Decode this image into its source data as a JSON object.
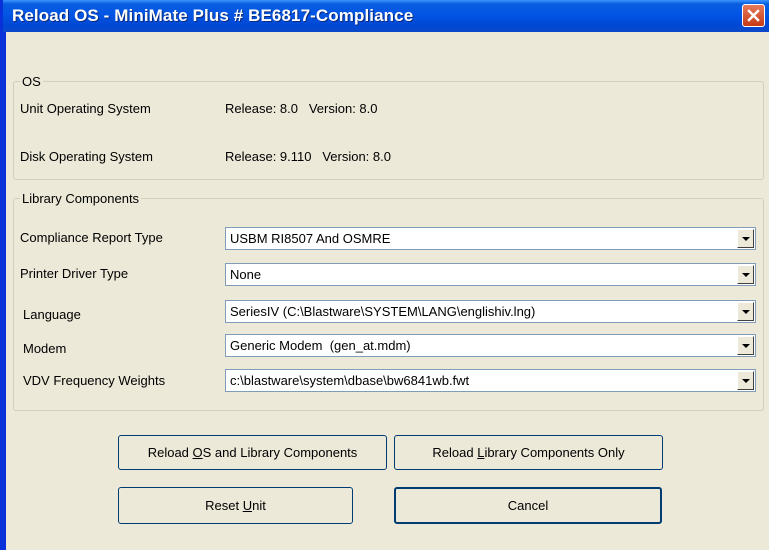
{
  "window": {
    "title": "Reload OS - MiniMate Plus # BE6817-Compliance"
  },
  "os_group": {
    "legend": "OS",
    "rows": [
      {
        "label": "Unit Operating System",
        "value": "Release: 8.0   Version: 8.0"
      },
      {
        "label": "Disk Operating System",
        "value": "Release: 9.110   Version: 8.0"
      }
    ]
  },
  "library_group": {
    "legend": "Library Components",
    "fields": [
      {
        "label": "Compliance Report Type",
        "value": "USBM RI8507 And OSMRE"
      },
      {
        "label": "Printer Driver Type",
        "value": "None"
      },
      {
        "label": "Language",
        "value": "SeriesIV (C:\\Blastware\\SYSTEM\\LANG\\englishiv.lng)"
      },
      {
        "label": "Modem",
        "value": "Generic Modem  (gen_at.mdm)"
      },
      {
        "label": "VDV Frequency Weights",
        "value": "c:\\blastware\\system\\dbase\\bw6841wb.fwt"
      }
    ]
  },
  "buttons": {
    "reload_os_pre": "Reload ",
    "reload_os_key": "O",
    "reload_os_post": "S and Library Components",
    "reload_lib_pre": "Reload ",
    "reload_lib_key": "L",
    "reload_lib_post": "ibrary Components Only",
    "reset_pre": "Reset ",
    "reset_key": "U",
    "reset_post": "nit",
    "cancel": "Cancel"
  }
}
